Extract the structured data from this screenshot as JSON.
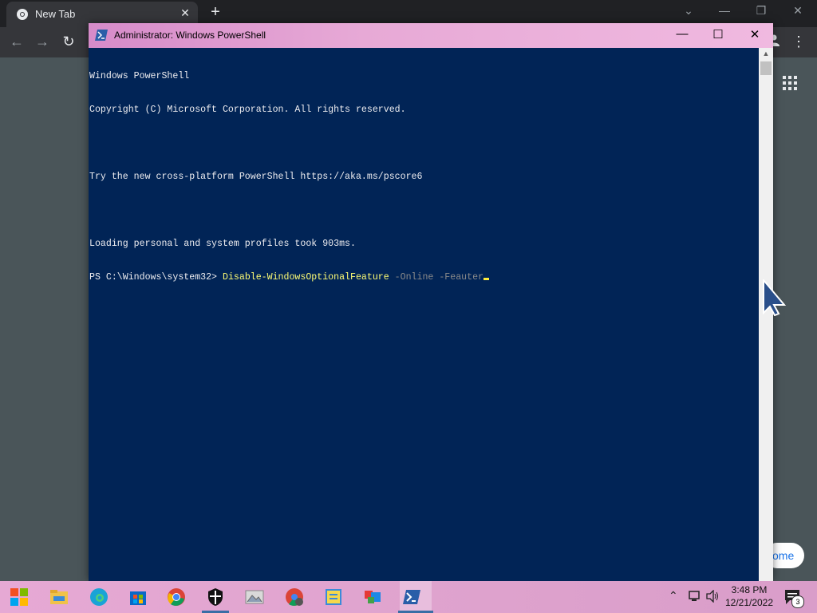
{
  "browser": {
    "tab_title": "New Tab",
    "customize_label": "ome"
  },
  "powershell": {
    "window_title": "Administrator: Windows PowerShell",
    "lines": [
      "Windows PowerShell",
      "Copyright (C) Microsoft Corporation. All rights reserved.",
      "",
      "Try the new cross-platform PowerShell https://aka.ms/pscore6",
      "",
      "Loading personal and system profiles took 903ms."
    ],
    "prompt": "PS C:\\Windows\\system32> ",
    "command": "Disable-WindowsOptionalFeature",
    "params": " -Online -Feauter"
  },
  "taskbar": {
    "time": "3:48 PM",
    "date": "12/21/2022",
    "notification_count": "3",
    "apps": [
      "start-icon",
      "file-explorer-icon",
      "edge-icon",
      "store-icon",
      "chrome-icon",
      "security-icon",
      "photos-icon",
      "chrome-alt-icon",
      "notes-icon",
      "mixed-reality-icon",
      "powershell-icon"
    ]
  }
}
